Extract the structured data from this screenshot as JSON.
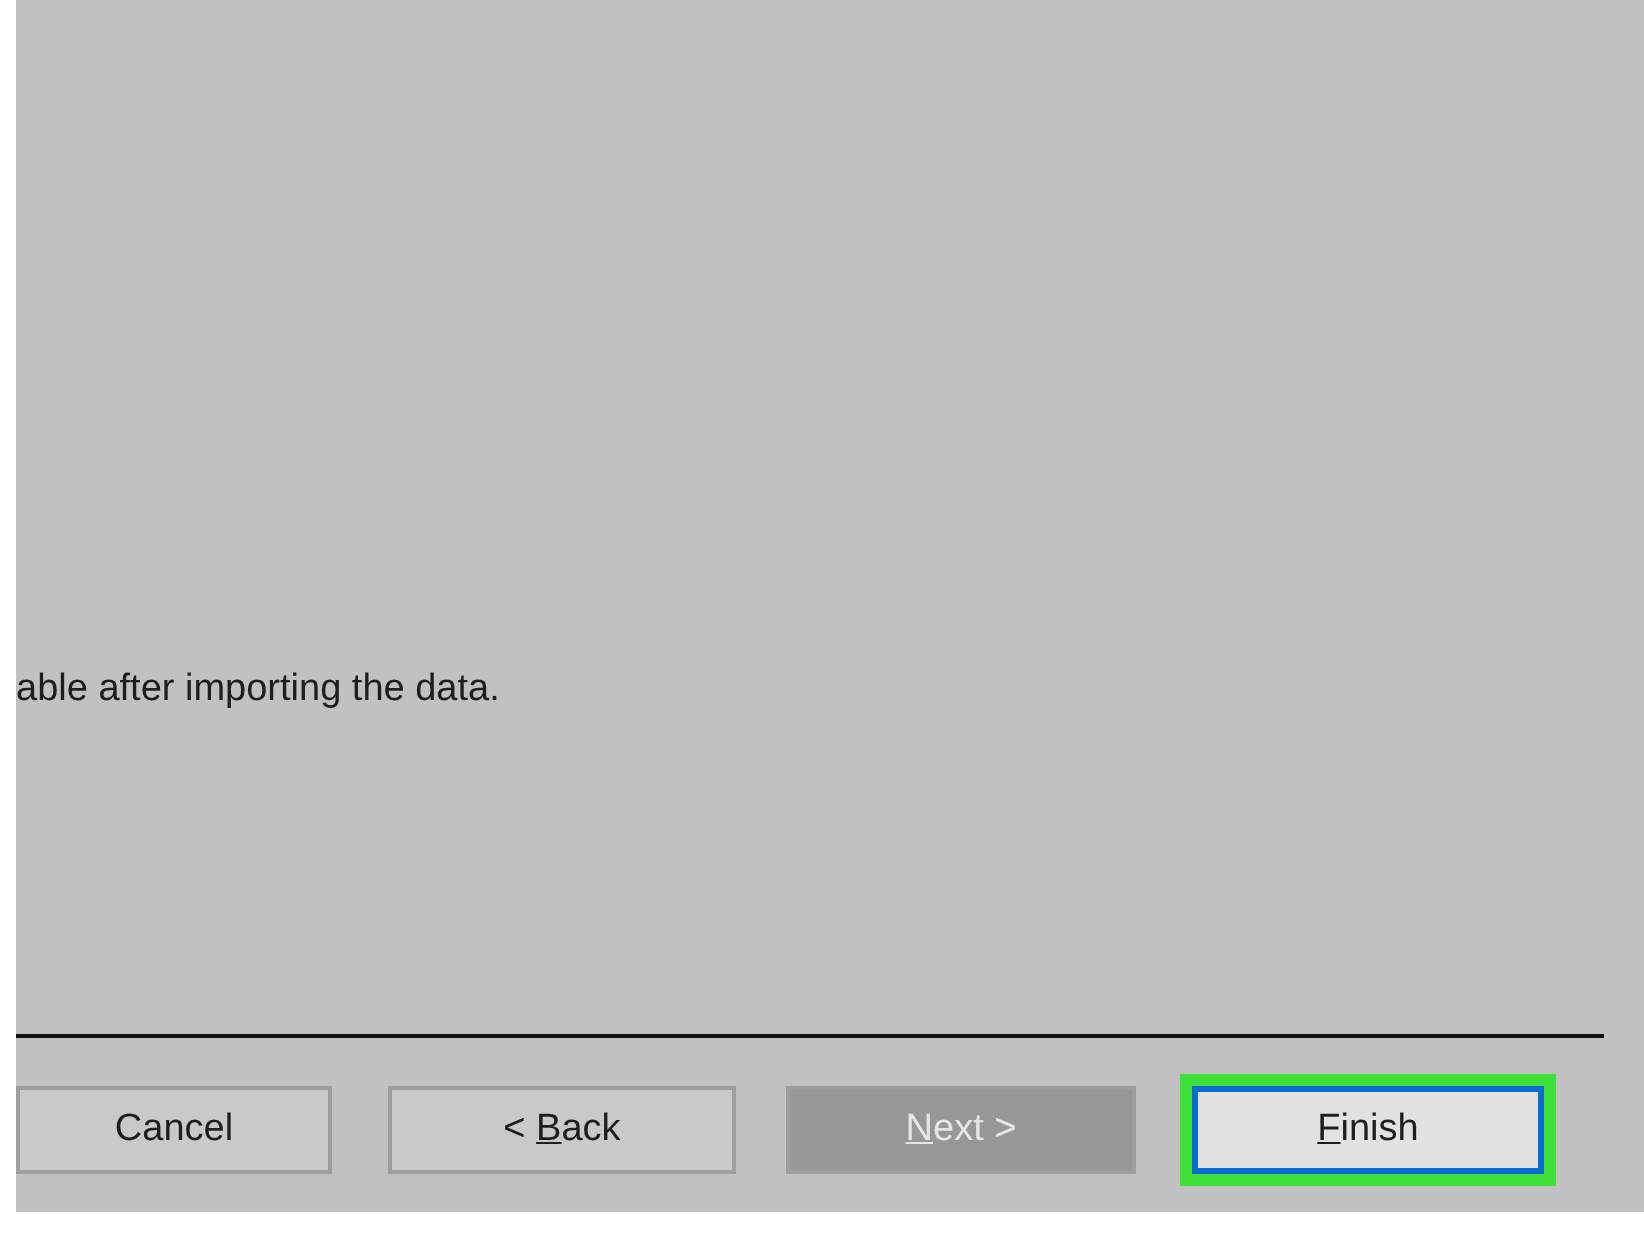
{
  "message": "able after importing the data.",
  "buttons": [
    {
      "label": {
        "before": "Cancel"
      },
      "disabled": false,
      "default": false,
      "highlighted": false
    },
    {
      "label": {
        "before": "< ",
        "access_key": "B",
        "after": "ack"
      },
      "disabled": false,
      "default": false,
      "highlighted": false
    },
    {
      "label": {
        "access_key": "N",
        "after": "ext >"
      },
      "disabled": true,
      "default": false,
      "highlighted": false
    },
    {
      "label": {
        "access_key": "F",
        "after": "inish"
      },
      "disabled": false,
      "default": true,
      "highlighted": true
    }
  ]
}
